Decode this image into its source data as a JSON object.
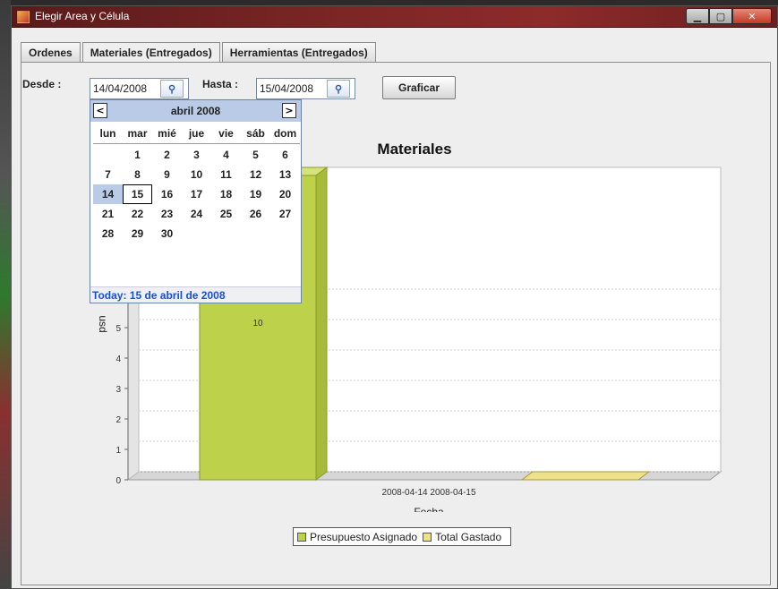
{
  "window": {
    "title": "Elegir Area y Célula"
  },
  "tabs": [
    {
      "label": "Ordenes"
    },
    {
      "label": "Materiales (Entregados)"
    },
    {
      "label": "Herramientas (Entregados)"
    }
  ],
  "form": {
    "desde_label": "Desde :",
    "desde_value": "14/04/2008",
    "hasta_label": "Hasta :",
    "hasta_value": "15/04/2008",
    "graficar_label": "Graficar"
  },
  "calendar": {
    "month": "abril 2008",
    "prev": "<",
    "next": ">",
    "weekdays": [
      "lun",
      "mar",
      "mié",
      "jue",
      "vie",
      "sáb",
      "dom"
    ],
    "start_offset": 1,
    "days": [
      "1",
      "2",
      "3",
      "4",
      "5",
      "6",
      "7",
      "8",
      "9",
      "10",
      "11",
      "12",
      "13",
      "14",
      "15",
      "16",
      "17",
      "18",
      "19",
      "20",
      "21",
      "22",
      "23",
      "24",
      "25",
      "26",
      "27",
      "28",
      "29",
      "30"
    ],
    "selected_day": "14",
    "today_day": "15",
    "today_text": "Today: 15 de abril de 2008"
  },
  "chart_data": {
    "type": "bar",
    "title": "Materiales",
    "xlabel": "Fecha",
    "ylabel": "usd",
    "categories": [
      "2008-04-14",
      "2008-04-15"
    ],
    "category_label": "2008-04-14 2008-04-15",
    "series": [
      {
        "name": "Presupuesto Asignado",
        "color": "#bdd14a",
        "values": [
          10,
          0
        ]
      },
      {
        "name": "Total Gastado",
        "color": "#ede28a",
        "values": [
          0,
          0
        ]
      }
    ],
    "data_labels": [
      "10"
    ],
    "y_ticks": [
      "0",
      "1",
      "2",
      "3",
      "4",
      "5",
      "6"
    ],
    "ylim": [
      0,
      10
    ],
    "grid": true,
    "legend": "bottom"
  }
}
